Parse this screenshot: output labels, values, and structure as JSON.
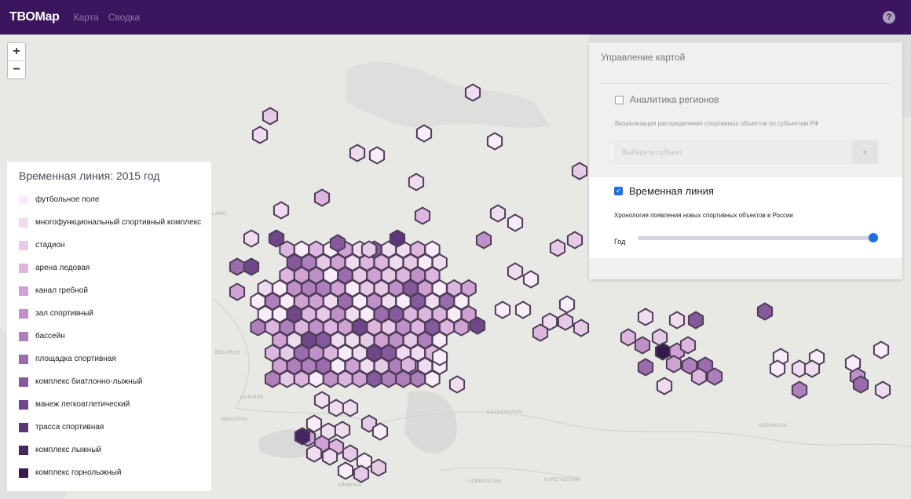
{
  "header": {
    "brand": "ТВОMap",
    "nav": [
      {
        "label": "Карта"
      },
      {
        "label": "Сводка"
      }
    ],
    "help_icon": "?"
  },
  "map": {
    "zoom_in": "+",
    "zoom_out": "−",
    "background_color": "#e9e9e6",
    "country_labels": [
      {
        "text": "LAND"
      },
      {
        "text": "BELARUS"
      },
      {
        "text": "UKRAINE"
      },
      {
        "text": "MOLDOVA"
      },
      {
        "text": "KAZAKHSTAN"
      },
      {
        "text": "MONGOLIA"
      },
      {
        "text": "UZBEKISTAN"
      },
      {
        "text": "KYRGYZSTAN"
      },
      {
        "text": "ARMENIA"
      }
    ]
  },
  "legend": {
    "title": "Временная линия: 2015 год",
    "items": [
      {
        "label": "футбольное поле",
        "color": "#f7ecf7"
      },
      {
        "label": "многофункциональный спортивный комплекс",
        "color": "#efdcef"
      },
      {
        "label": "стадион",
        "color": "#e6cbe6"
      },
      {
        "label": "арена ледовая",
        "color": "#dcb6de"
      },
      {
        "label": "канал гребной",
        "color": "#cfa2d3"
      },
      {
        "label": "зал спортивный",
        "color": "#c091c8"
      },
      {
        "label": "бассейн",
        "color": "#ad7fbb"
      },
      {
        "label": "площадка спортивная",
        "color": "#9a6cad"
      },
      {
        "label": "комплекс биатлонно-лыжный",
        "color": "#855a9c"
      },
      {
        "label": "манеж легкоатлетический",
        "color": "#6f4789"
      },
      {
        "label": "трасса спортивная",
        "color": "#5a3676"
      },
      {
        "label": "комплекс лыжный",
        "color": "#46265f"
      },
      {
        "label": "комплекс горнолыжный",
        "color": "#36194d"
      }
    ]
  },
  "panel": {
    "title": "Управление картой",
    "analytics": {
      "label": "Аналитика регионов",
      "checked": false,
      "description": "Визуализация распределения спортивных объектов по субъектам РФ",
      "select_placeholder": "Выберите субъект"
    },
    "timeline": {
      "label": "Временная линия",
      "checked": true,
      "description": "Хронология появления новых спортивных объектов в России",
      "year_label": "Год",
      "slider_fraction": 1.0
    }
  },
  "colors": {
    "header": "#3b155e",
    "accent": "#1f6fe0",
    "hex_stroke": "#4e3d58"
  }
}
